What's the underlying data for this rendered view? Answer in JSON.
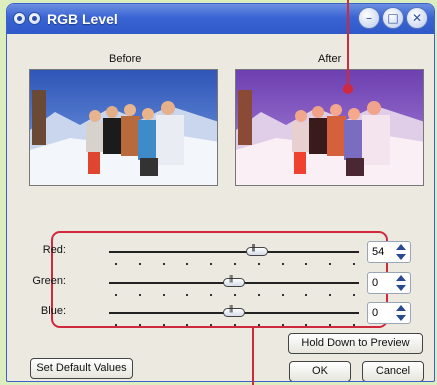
{
  "window": {
    "title": "RGB Level",
    "title_icon": "app-icon",
    "controls": [
      "minimize-icon",
      "maximize-icon",
      "close-icon"
    ]
  },
  "preview": {
    "before_label": "Before",
    "after_label": "After"
  },
  "sliders": [
    {
      "label": "Red:",
      "value": "54",
      "thumb_fraction": 0.59
    },
    {
      "label": "Green:",
      "value": "0",
      "thumb_fraction": 0.5
    },
    {
      "label": "Blue:",
      "value": "0",
      "thumb_fraction": 0.5
    }
  ],
  "buttons": {
    "hold_preview": "Hold Down to Preview",
    "set_defaults": "Set Default Values",
    "ok": "OK",
    "cancel": "Cancel"
  },
  "colors": {
    "title_bar": "#3a64d4",
    "callout": "#d0293e",
    "background": "#dceec0"
  }
}
